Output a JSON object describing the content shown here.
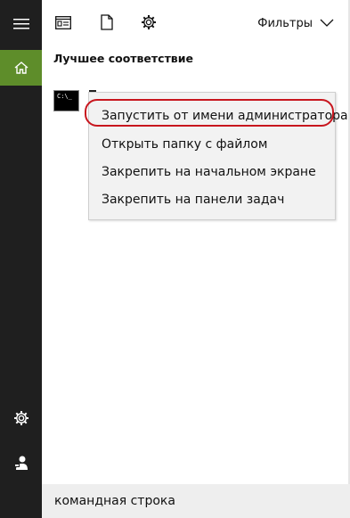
{
  "toolbar": {
    "filters_label": "Фильтры"
  },
  "icons": {
    "hamburger": "hamburger-icon",
    "home": "home-icon",
    "settings": "gear-icon",
    "user": "user-icon",
    "documents_list": "documents-list-icon",
    "document": "document-icon",
    "toolbar_settings": "gear-icon",
    "chevron": "chevron-down-icon"
  },
  "section": {
    "best_match_title": "Лучшее соответствие"
  },
  "result": {
    "icon_text": "C:\\_"
  },
  "context_menu": {
    "items": [
      {
        "label": "Запустить от имени администратора"
      },
      {
        "label": "Открыть папку с файлом"
      },
      {
        "label": "Закрепить на начальном экране"
      },
      {
        "label": "Закрепить на панели задач"
      }
    ]
  },
  "search": {
    "value": "командная строка"
  },
  "colors": {
    "rail": "#1f1f1f",
    "home_accent": "#5e8d2a",
    "highlight": "#c8161e"
  }
}
